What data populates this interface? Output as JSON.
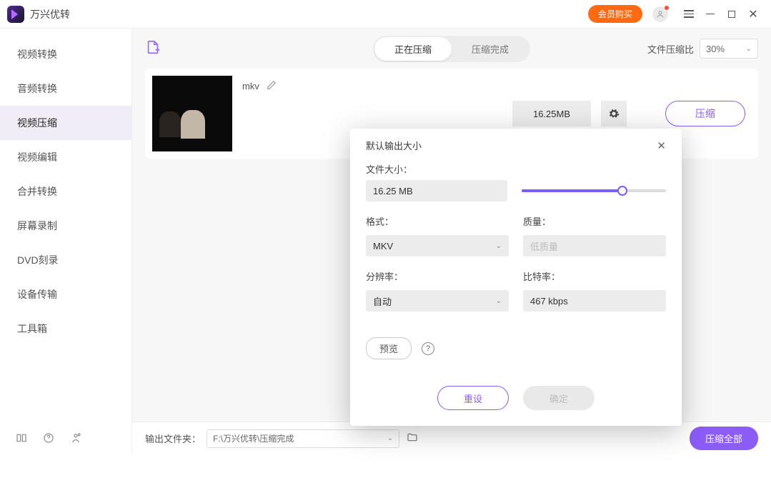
{
  "colors": {
    "accent": "#8b5cf6",
    "button_orange": "#ff6a13"
  },
  "titlebar": {
    "app_name": "万兴优转",
    "purchase": "会员购买"
  },
  "sidebar": {
    "items": [
      {
        "label": "视频转换"
      },
      {
        "label": "音频转换"
      },
      {
        "label": "视频压缩"
      },
      {
        "label": "视频编辑"
      },
      {
        "label": "合并转换"
      },
      {
        "label": "屏幕录制"
      },
      {
        "label": "DVD刻录"
      },
      {
        "label": "设备传输"
      },
      {
        "label": "工具箱"
      }
    ],
    "active_index": 2
  },
  "toolbar": {
    "tabs": {
      "compressing": "正在压缩",
      "done": "压缩完成"
    },
    "ratio_label": "文件压缩比",
    "ratio_value": "30%"
  },
  "file_card": {
    "name": "mkv",
    "output_size": "16.25MB",
    "compress_btn": "压缩"
  },
  "modal": {
    "title": "默认输出大小",
    "file_size_label": "文件大小：",
    "file_size_value": "16.25 MB",
    "slider_percent": 70,
    "format_label": "格式：",
    "format_value": "MKV",
    "quality_label": "质量：",
    "quality_placeholder": "低质量",
    "resolution_label": "分辨率：",
    "resolution_value": "自动",
    "bitrate_label": "比特率：",
    "bitrate_value": "467 kbps",
    "preview": "预览",
    "reset": "重设",
    "confirm": "确定"
  },
  "bottom": {
    "output_label": "输出文件夹：",
    "output_path": "F:\\万兴优转\\压缩完成",
    "compress_all": "压缩全部"
  }
}
